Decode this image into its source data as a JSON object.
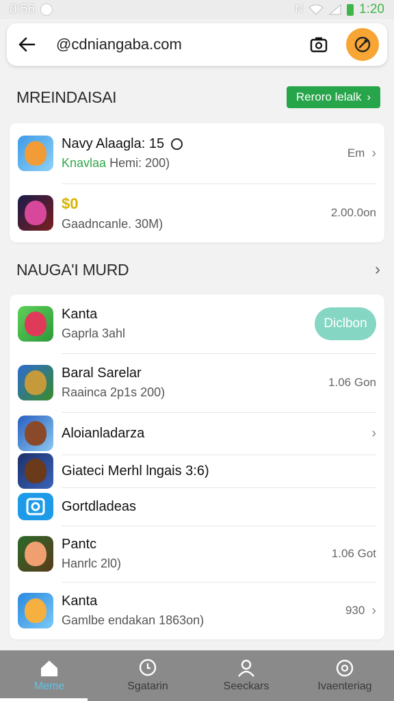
{
  "status_bar": {
    "time_left": "0:56",
    "time_right": "1:20",
    "network": "N"
  },
  "search": {
    "url": "@cdniangaba.com"
  },
  "section1": {
    "title": "MREINDAISAI",
    "button_label": "Reroro lelalk",
    "items": [
      {
        "name": "Navy Alaagla: 15",
        "sub_green": "Knavlaa",
        "sub": "Hemi: 200)",
        "right": "Em",
        "icon": "cat-game-icon"
      },
      {
        "name": "$0",
        "sub": "Gaadncanle. 30M)",
        "right": "2.00.0on",
        "icon": "action-game-icon"
      }
    ]
  },
  "section2": {
    "title": "NAUGA'I MURD",
    "items": [
      {
        "name": "Kanta",
        "sub": "Gaprla 3ahl",
        "right_button": "Diclbon",
        "icon": "red-character-icon"
      },
      {
        "name": "Baral Sarelar",
        "sub": "Raainca 2p1s 200)",
        "right": "1.06 Gon",
        "icon": "warrior-game-icon"
      },
      {
        "name": "Aloianladarza",
        "sub": "",
        "right": "",
        "icon": "fantasy-character-icon"
      },
      {
        "name": "Giateci Merhl lngais 3:6)",
        "sub": "",
        "right": "",
        "icon": "monster-character-icon"
      },
      {
        "name": "Gortdladeas",
        "sub": "",
        "right": "",
        "icon": "camera-app-icon"
      },
      {
        "name": "Pantc",
        "sub": "Hanrlc 2l0)",
        "right": "1.06 Got",
        "icon": "girl-character-icon"
      },
      {
        "name": "Kanta",
        "sub": "Gamlbe endakan 1863on)",
        "right": "930",
        "icon": "fox-character-icon"
      }
    ]
  },
  "bottom_nav": [
    {
      "label": "Meme",
      "icon": "home-icon"
    },
    {
      "label": "Sgatarin",
      "icon": "chat-icon"
    },
    {
      "label": "Seeckars",
      "icon": "person-icon"
    },
    {
      "label": "Ivaenteriag",
      "icon": "settings-icon"
    }
  ],
  "colors": {
    "accent_green": "#27a54a",
    "orange": "#f7a534",
    "teal_pill": "#86d6c4",
    "nav_active": "#5cc3e8"
  }
}
